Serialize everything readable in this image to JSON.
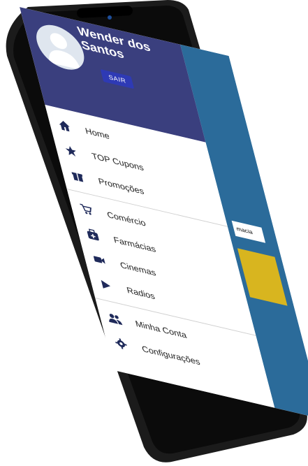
{
  "user": {
    "name": "Wender dos Santos",
    "logout_label": "SAIR"
  },
  "menu": {
    "group1": [
      {
        "label": "Home",
        "icon": "home-icon"
      },
      {
        "label": "TOP Cupons",
        "icon": "star-icon"
      },
      {
        "label": "Promoções",
        "icon": "gift-icon"
      }
    ],
    "group2": [
      {
        "label": "Comércio",
        "icon": "cart-icon"
      },
      {
        "label": "Farmácias",
        "icon": "medical-kit-icon"
      },
      {
        "label": "Cinemas",
        "icon": "video-camera-icon"
      },
      {
        "label": "Radios",
        "icon": "play-icon"
      }
    ],
    "group3": [
      {
        "label": "Minha Conta",
        "icon": "people-icon"
      },
      {
        "label": "Configurações",
        "icon": "gear-icon"
      }
    ]
  },
  "background_app": {
    "label": "macia"
  },
  "colors": {
    "header": "#3a3f7e",
    "button": "#2e3ab5",
    "icon": "#1f2a5a"
  }
}
